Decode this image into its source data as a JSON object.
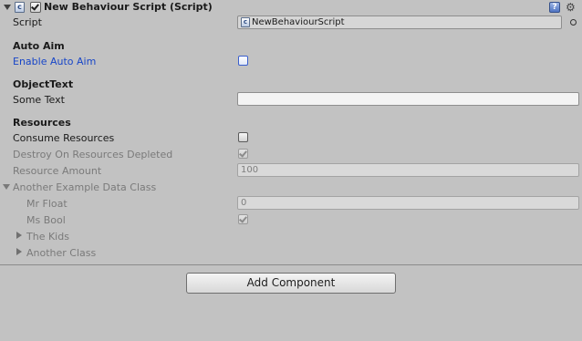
{
  "header": {
    "title": "New Behaviour Script (Script)",
    "enabled": true,
    "help_icon": "?",
    "settings_icon": "⚙"
  },
  "script": {
    "label": "Script",
    "value": "NewBehaviourScript",
    "icon_glyph": "c"
  },
  "auto_aim": {
    "section_title": "Auto Aim",
    "enable_label": "Enable Auto Aim",
    "enable_checked": false
  },
  "object_text": {
    "section_title": "ObjectText",
    "some_text_label": "Some Text",
    "some_text_value": ""
  },
  "resources": {
    "section_title": "Resources",
    "consume_label": "Consume Resources",
    "consume_checked": false,
    "destroy_label": "Destroy On Resources Depleted",
    "destroy_checked": true,
    "amount_label": "Resource Amount",
    "amount_value": "100"
  },
  "example_class": {
    "label": "Another Example Data Class",
    "expanded": true,
    "mr_float_label": "Mr Float",
    "mr_float_value": "0",
    "ms_bool_label": "Ms Bool",
    "ms_bool_checked": true,
    "the_kids_label": "The Kids",
    "another_class_label": "Another Class"
  },
  "footer": {
    "add_component_label": "Add Component"
  },
  "colors": {
    "background": "#c2c2c2",
    "focus_label": "#1846c8",
    "disabled_label": "#7a7a7a"
  }
}
